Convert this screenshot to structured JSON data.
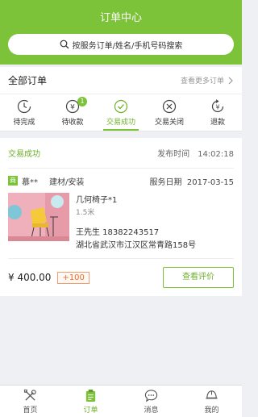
{
  "header": {
    "title": "订单中心",
    "search_placeholder": "按服务订单/姓名/手机号码搜索"
  },
  "all_orders": {
    "title": "全部订单",
    "more_label": "查看更多订单"
  },
  "tabs": [
    {
      "label": "待完成",
      "icon": "clock-icon"
    },
    {
      "label": "待收款",
      "icon": "payment-icon",
      "badge": "1"
    },
    {
      "label": "交易成功",
      "icon": "check-circle-icon",
      "active": true
    },
    {
      "label": "交易关闭",
      "icon": "x-circle-icon"
    },
    {
      "label": "退款",
      "icon": "refund-icon"
    }
  ],
  "order": {
    "status": "交易成功",
    "publish_label": "发布时间",
    "publish_time": "14:02:18",
    "shop_tag": "商",
    "merchant": "慕**",
    "category": "建材/安装",
    "service_date_label": "服务日期",
    "service_date": "2017-03-15",
    "product_name": "几何椅子*1",
    "product_spec": "1.5米",
    "contact": "王先生  18382243517",
    "address": "湖北省武汉市江汉区常青路158号",
    "price": "¥ 400.00",
    "points": "+100",
    "action_label": "查看评价"
  },
  "nav": [
    {
      "label": "首页",
      "icon": "tools-icon"
    },
    {
      "label": "订单",
      "icon": "clipboard-icon",
      "active": true
    },
    {
      "label": "消息",
      "icon": "chat-icon"
    },
    {
      "label": "我的",
      "icon": "helmet-icon"
    }
  ],
  "colors": {
    "accent": "#7dc33a",
    "points": "#e86d2e"
  }
}
